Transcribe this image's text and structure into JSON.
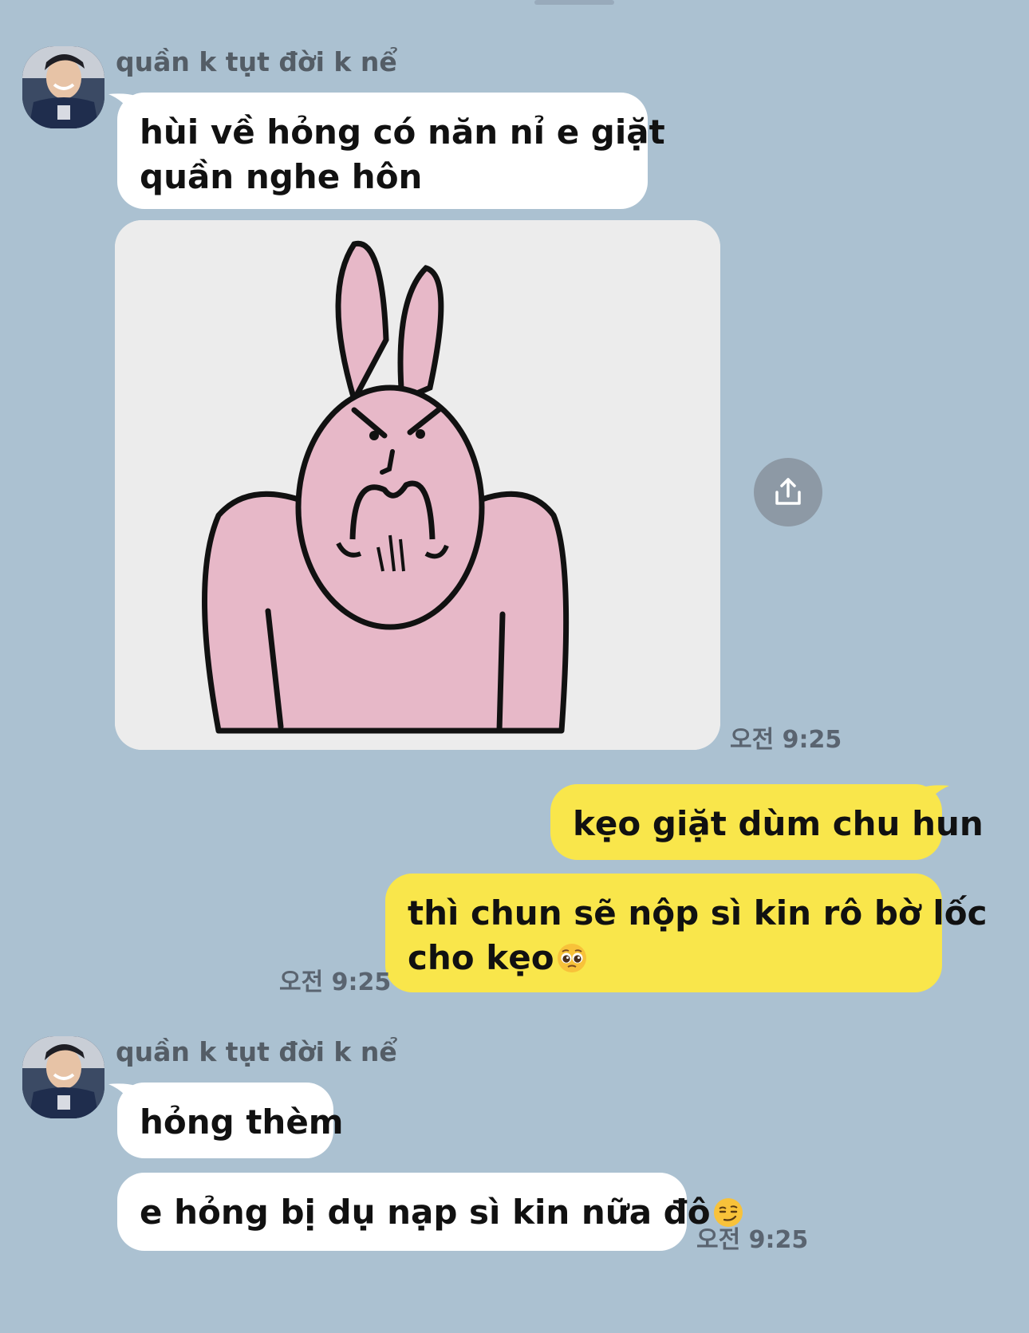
{
  "chat": {
    "background_color": "#abc1d1",
    "incoming_bubble_color": "#ffffff",
    "outgoing_bubble_color": "#f9e64b",
    "groups": [
      {
        "sender_name": "quần k tụt đời k nể",
        "messages": [
          {
            "line1": "hùi về hỏng có năn nỉ e giặt",
            "line2": "quần nghe hôn"
          },
          {
            "type": "sticker",
            "sticker": "angry-pink-rabbit-sticker"
          }
        ],
        "time": "오전 9:25"
      },
      {
        "sender": "me",
        "messages": [
          {
            "text": "kẹo giặt dùm chu hun"
          },
          {
            "line1": "thì chun sẽ nộp sì kin rô bờ lốc",
            "line2": "cho kẹo",
            "emoji": "pleading-face"
          }
        ],
        "time": "오전 9:25"
      },
      {
        "sender_name": "quần k tụt đời k nể",
        "messages": [
          {
            "text": "hỏng thèm"
          },
          {
            "text": "e hỏng bị dụ nạp sì kin nữa đô",
            "emoji": "smirking-face"
          }
        ],
        "time": "오전 9:25"
      }
    ],
    "icons": {
      "share": "share-icon",
      "avatar": "profile-photo"
    }
  }
}
